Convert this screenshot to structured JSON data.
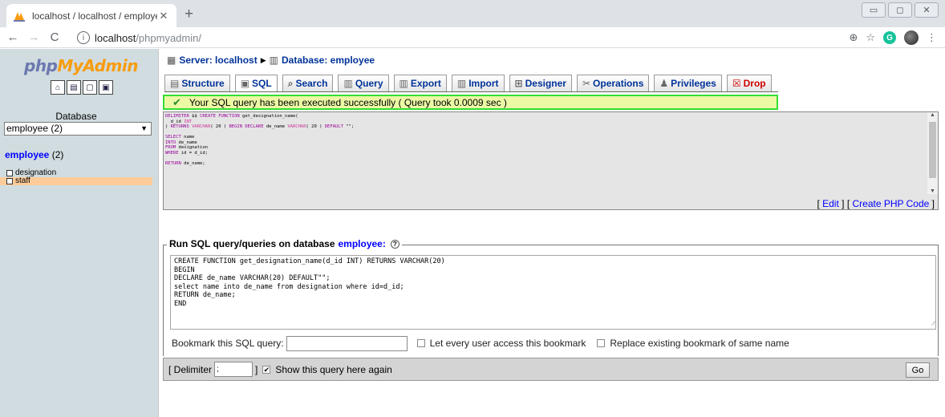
{
  "browser": {
    "tab_title": "localhost / localhost / employee",
    "tab_close": "✕",
    "new_tab": "+",
    "url_host": "localhost",
    "url_path": "/phpmyadmin/",
    "window_buttons": [
      "▭",
      "◻",
      "✕"
    ]
  },
  "sidebar": {
    "logo_part1": "php",
    "logo_part2": "MyAdmin",
    "db_label": "Database",
    "db_select_value": "employee (2)",
    "db_link_name": "employee",
    "db_link_count": " (2)",
    "tables": [
      "designation",
      "staff"
    ]
  },
  "breadcrumb": {
    "server": "Server: localhost",
    "database": "Database: employee"
  },
  "tabs": [
    "Structure",
    "SQL",
    "Search",
    "Query",
    "Export",
    "Import",
    "Designer",
    "Operations",
    "Privileges",
    "Drop"
  ],
  "success_message": "Your SQL query has been executed successfully ( Query took 0.0009 sec )",
  "query_links": {
    "edit": "Edit",
    "create_php": "Create PHP Code"
  },
  "run_sql": {
    "legend": "Run SQL query/queries on database",
    "database": "employee:",
    "help": "?",
    "query_text": "CREATE FUNCTION get_designation_name(d_id INT) RETURNS VARCHAR(20)\nBEGIN\nDECLARE de_name VARCHAR(20) DEFAULT\"\";\nselect name into de_name from designation where id=d_id;\nRETURN de_name;\nEND",
    "bookmark_label": "Bookmark this SQL query:",
    "bookmark_value": "",
    "share_label": "Let every user access this bookmark",
    "replace_label": "Replace existing bookmark of same name",
    "delimiter_label": "[ Delimiter",
    "delimiter_value": ";",
    "delimiter_close": "]",
    "show_again_label": "Show this query here again",
    "go_label": "Go"
  }
}
